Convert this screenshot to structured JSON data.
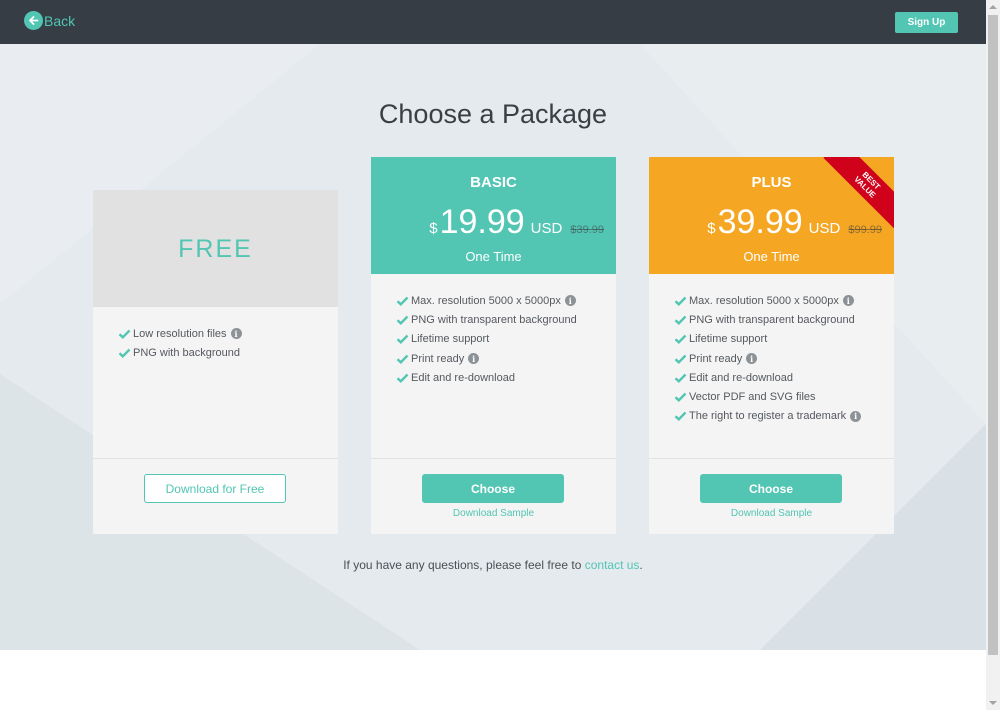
{
  "header": {
    "back_label": "Back",
    "signup_label": "Sign Up"
  },
  "title": "Choose a Package",
  "colors": {
    "accent": "#52c5b3",
    "plus": "#f5a623",
    "ribbon": "#d0021b",
    "topbar": "#363d45"
  },
  "free": {
    "title": "FREE",
    "features": [
      {
        "text": "Low resolution files",
        "info": true
      },
      {
        "text": "PNG with background",
        "info": false
      }
    ],
    "button_label": "Download for Free"
  },
  "basic": {
    "name": "BASIC",
    "currency_symbol": "$",
    "price": "19.99",
    "currency": "USD",
    "old_price": "$39.99",
    "term": "One Time",
    "features": [
      {
        "text": "Max. resolution 5000 x 5000px",
        "info": true
      },
      {
        "text": "PNG with transparent background",
        "info": false
      },
      {
        "text": "Lifetime support",
        "info": false
      },
      {
        "text": "Print ready",
        "info": true
      },
      {
        "text": "Edit and re-download",
        "info": false
      }
    ],
    "button_label": "Choose",
    "sample_label": "Download Sample"
  },
  "plus": {
    "name": "PLUS",
    "ribbon_line1": "BEST",
    "ribbon_line2": "VALUE",
    "currency_symbol": "$",
    "price": "39.99",
    "currency": "USD",
    "old_price": "$99.99",
    "term": "One Time",
    "features": [
      {
        "text": "Max. resolution 5000 x 5000px",
        "info": true
      },
      {
        "text": "PNG with transparent background",
        "info": false
      },
      {
        "text": "Lifetime support",
        "info": false
      },
      {
        "text": "Print ready",
        "info": true
      },
      {
        "text": "Edit and re-download",
        "info": false
      },
      {
        "text": "Vector PDF and SVG files",
        "info": false
      },
      {
        "text": "The right to register a trademark",
        "info": true
      }
    ],
    "button_label": "Choose",
    "sample_label": "Download Sample"
  },
  "footer_note": {
    "text": "If you have any questions, please feel free to ",
    "link": "contact us",
    "end": "."
  }
}
